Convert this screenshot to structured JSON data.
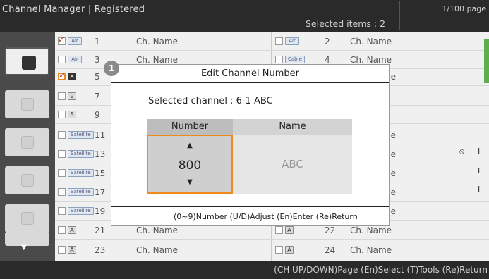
{
  "header": {
    "title": "Channel Manager | Registered",
    "selected_items": "Selected items : 2",
    "page_indicator": "1/100 page"
  },
  "left_groups": [
    {
      "active": true
    },
    {
      "active": false
    },
    {
      "active": false
    },
    {
      "active": false
    },
    {
      "active": false
    },
    {
      "active": false
    }
  ],
  "channels_left": [
    {
      "checked": true,
      "type": "Air",
      "num": "1",
      "name": "Ch. Name"
    },
    {
      "checked": false,
      "type": "Air",
      "num": "3",
      "name": "Ch. Name"
    },
    {
      "checked": true,
      "type": "X",
      "num": "5",
      "name": "",
      "highlight": true
    },
    {
      "checked": false,
      "type": "V",
      "num": "7",
      "name": ""
    },
    {
      "checked": false,
      "type": "S",
      "num": "9",
      "name": ""
    },
    {
      "checked": false,
      "type": "Satellite",
      "num": "11",
      "name": ""
    },
    {
      "checked": false,
      "type": "Satellite",
      "num": "13",
      "name": ""
    },
    {
      "checked": false,
      "type": "Satellite",
      "num": "15",
      "name": ""
    },
    {
      "checked": false,
      "type": "Satellite",
      "num": "17",
      "name": ""
    },
    {
      "checked": false,
      "type": "Satellite",
      "num": "19",
      "name": ""
    },
    {
      "checked": false,
      "type": "A",
      "num": "21",
      "name": "Ch. Name"
    },
    {
      "checked": false,
      "type": "A",
      "num": "23",
      "name": "Ch. Name"
    }
  ],
  "channels_right": [
    {
      "checked": false,
      "type": "Air",
      "num": "2",
      "name": "Ch. Name"
    },
    {
      "checked": false,
      "type": "Cable",
      "num": "4",
      "name": "Ch. Name"
    },
    {
      "checked": false,
      "type": "",
      "num": "",
      "name": "ne"
    },
    {
      "checked": false,
      "type": "",
      "num": "",
      "name": ""
    },
    {
      "checked": false,
      "type": "",
      "num": "",
      "name": ""
    },
    {
      "checked": false,
      "type": "",
      "num": "",
      "name": "ne"
    },
    {
      "checked": false,
      "type": "",
      "num": "",
      "name": "ne"
    },
    {
      "checked": false,
      "type": "",
      "num": "",
      "name": "ne"
    },
    {
      "checked": false,
      "type": "",
      "num": "",
      "name": "ne"
    },
    {
      "checked": false,
      "type": "",
      "num": "",
      "name": "ne"
    },
    {
      "checked": false,
      "type": "A",
      "num": "22",
      "name": "Ch. Name"
    },
    {
      "checked": false,
      "type": "A",
      "num": "24",
      "name": "Ch. Name"
    }
  ],
  "dialog": {
    "title": "Edit Channel Number",
    "selected_channel": "Selected channel : 6-1 ABC",
    "col_number": "Number",
    "col_name": "Name",
    "number_value": "800",
    "name_value": "ABC",
    "up_arrow": "▲",
    "down_arrow": "▼",
    "hint": "(0~9)Number  (U/D)Adjust  (En)Enter  (Re)Return"
  },
  "callout": "1",
  "footer": {
    "hint": "(CH UP/DOWN)Page  (En)Select  (T)Tools  (Re)Return"
  },
  "scroll_down": "▼",
  "row_icons": [
    "mute-icon",
    "edit-icon"
  ],
  "colors": {
    "accent_orange": "#f08a1e",
    "check_red": "#c0392b",
    "green_marker": "#5fae4c"
  }
}
